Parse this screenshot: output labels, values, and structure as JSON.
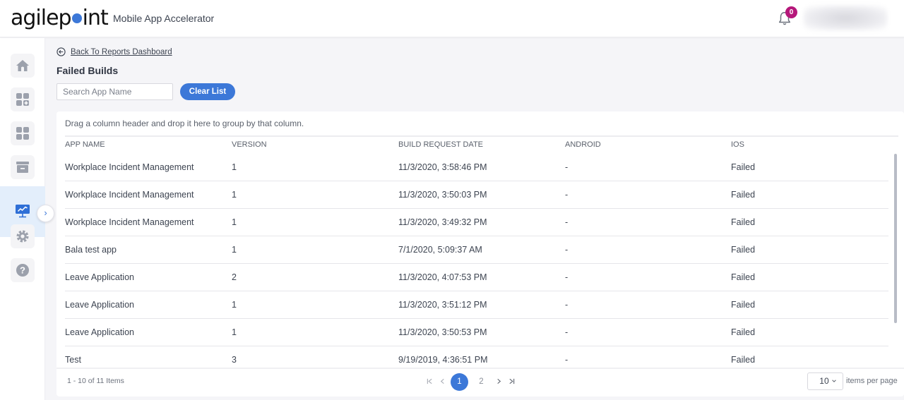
{
  "header": {
    "logo_text_left": "agilep",
    "logo_text_right": "int",
    "app_title": "Mobile App Accelerator",
    "notification_count": "0",
    "colors": {
      "accent": "#3c78d8",
      "badge": "#b5177a"
    }
  },
  "sidebar": {
    "items": [
      {
        "name": "home",
        "icon": "home-icon",
        "active": false
      },
      {
        "name": "create-app",
        "icon": "apps-add-icon",
        "active": false
      },
      {
        "name": "apps",
        "icon": "apps-grid-icon",
        "active": false
      },
      {
        "name": "archive",
        "icon": "archive-icon",
        "active": false
      },
      {
        "name": "reports",
        "icon": "reports-monitor-icon",
        "active": true
      },
      {
        "name": "settings",
        "icon": "gear-icon",
        "active": false
      },
      {
        "name": "help",
        "icon": "help-icon",
        "active": false
      }
    ],
    "expand_icon": "›"
  },
  "main": {
    "back_link": "Back To Reports Dashboard",
    "page_title": "Failed Builds",
    "search": {
      "placeholder": "Search App Name",
      "value": ""
    },
    "clear_button": "Clear List"
  },
  "grid": {
    "group_hint": "Drag a column header and drop it here to group by that column.",
    "columns": [
      "APP NAME",
      "VERSION",
      "BUILD REQUEST DATE",
      "ANDROID",
      "IOS"
    ],
    "rows": [
      [
        "Workplace Incident Management",
        "1",
        "11/3/2020, 3:58:46 PM",
        "-",
        "Failed"
      ],
      [
        "Workplace Incident Management",
        "1",
        "11/3/2020, 3:50:03 PM",
        "-",
        "Failed"
      ],
      [
        "Workplace Incident Management",
        "1",
        "11/3/2020, 3:49:32 PM",
        "-",
        "Failed"
      ],
      [
        "Bala test app",
        "1",
        "7/1/2020, 5:09:37 AM",
        "-",
        "Failed"
      ],
      [
        "Leave Application",
        "2",
        "11/3/2020, 4:07:53 PM",
        "-",
        "Failed"
      ],
      [
        "Leave Application",
        "1",
        "11/3/2020, 3:51:12 PM",
        "-",
        "Failed"
      ],
      [
        "Leave Application",
        "1",
        "11/3/2020, 3:50:53 PM",
        "-",
        "Failed"
      ],
      [
        "Test",
        "3",
        "9/19/2019, 4:36:51 PM",
        "-",
        "Failed"
      ]
    ],
    "pager": {
      "info": "1 - 10 of 11 Items",
      "first": "⇤",
      "prev": "‹",
      "pages": [
        "1",
        "2"
      ],
      "current_page": "1",
      "next": "›",
      "last": "⇥",
      "page_size": "10",
      "page_size_label": "items per page"
    }
  }
}
